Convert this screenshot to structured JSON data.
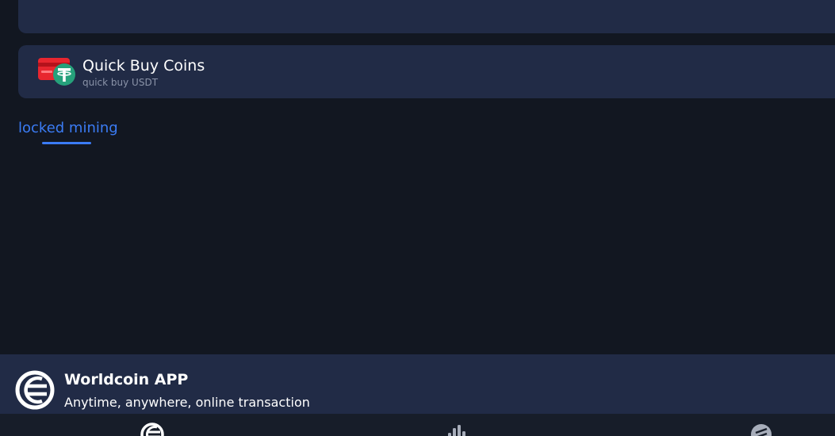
{
  "quick_buy": {
    "title": "Quick Buy Coins",
    "subtitle": "quick buy USDT",
    "icon": "usdt-card-icon"
  },
  "tabs": [
    {
      "label": "locked mining",
      "active": true
    }
  ],
  "app_banner": {
    "title": "Worldcoin APP",
    "subtitle": "Anytime, anywhere, online transaction",
    "icon": "worldcoin-logo-icon"
  },
  "bottom_nav": {
    "items": [
      {
        "icon": "worldcoin-home-icon"
      },
      {
        "icon": "market-chart-icon"
      },
      {
        "icon": "trade-icon"
      }
    ]
  },
  "colors": {
    "background": "#121721",
    "card": "#212b46",
    "accent": "#3b7cf5",
    "usdt_green": "#26a17b",
    "card_red": "#e8262f"
  }
}
